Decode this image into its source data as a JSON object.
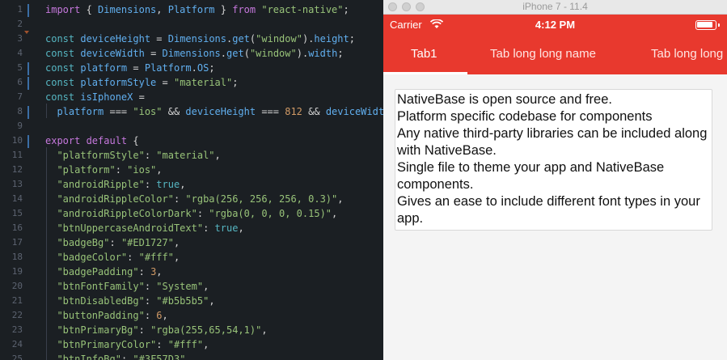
{
  "editor": {
    "lines": [
      {
        "n": "1",
        "tokens": [
          [
            "kw",
            "import "
          ],
          [
            "plain",
            "{ "
          ],
          [
            "id",
            "Dimensions"
          ],
          [
            "plain",
            ", "
          ],
          [
            "id",
            "Platform"
          ],
          [
            "plain",
            " } "
          ],
          [
            "kw",
            "from "
          ],
          [
            "str",
            "\"react-native\""
          ],
          [
            "plain",
            ";"
          ]
        ]
      },
      {
        "n": "2",
        "tokens": []
      },
      {
        "n": "3",
        "tokens": [
          [
            "kw2",
            "const "
          ],
          [
            "id",
            "deviceHeight"
          ],
          [
            "plain",
            " = "
          ],
          [
            "id",
            "Dimensions"
          ],
          [
            "plain",
            "."
          ],
          [
            "fn",
            "get"
          ],
          [
            "plain",
            "("
          ],
          [
            "str",
            "\"window\""
          ],
          [
            "plain",
            ")."
          ],
          [
            "id",
            "height"
          ],
          [
            "plain",
            ";"
          ]
        ]
      },
      {
        "n": "4",
        "tokens": [
          [
            "kw2",
            "const "
          ],
          [
            "id",
            "deviceWidth"
          ],
          [
            "plain",
            " = "
          ],
          [
            "id",
            "Dimensions"
          ],
          [
            "plain",
            "."
          ],
          [
            "fn",
            "get"
          ],
          [
            "plain",
            "("
          ],
          [
            "str",
            "\"window\""
          ],
          [
            "plain",
            ")."
          ],
          [
            "id",
            "width"
          ],
          [
            "plain",
            ";"
          ]
        ]
      },
      {
        "n": "5",
        "tokens": [
          [
            "kw2",
            "const "
          ],
          [
            "id",
            "platform"
          ],
          [
            "plain",
            " = "
          ],
          [
            "id",
            "Platform"
          ],
          [
            "plain",
            "."
          ],
          [
            "id",
            "OS"
          ],
          [
            "plain",
            ";"
          ]
        ]
      },
      {
        "n": "6",
        "tokens": [
          [
            "kw2",
            "const "
          ],
          [
            "id",
            "platformStyle"
          ],
          [
            "plain",
            " = "
          ],
          [
            "str",
            "\"material\""
          ],
          [
            "plain",
            ";"
          ]
        ]
      },
      {
        "n": "7",
        "tokens": [
          [
            "kw2",
            "const "
          ],
          [
            "id",
            "isIphoneX"
          ],
          [
            "plain",
            " ="
          ]
        ]
      },
      {
        "n": "8",
        "tokens": [
          [
            "plain",
            "  "
          ],
          [
            "id",
            "platform"
          ],
          [
            "plain",
            " === "
          ],
          [
            "str",
            "\"ios\""
          ],
          [
            "plain",
            " && "
          ],
          [
            "id",
            "deviceHeight"
          ],
          [
            "plain",
            " === "
          ],
          [
            "num",
            "812"
          ],
          [
            "plain",
            " && "
          ],
          [
            "id",
            "deviceWidt"
          ]
        ]
      },
      {
        "n": "9",
        "tokens": []
      },
      {
        "n": "10",
        "tokens": [
          [
            "kw",
            "export "
          ],
          [
            "kw",
            "default "
          ],
          [
            "plain",
            "{"
          ]
        ]
      },
      {
        "n": "11",
        "tokens": [
          [
            "plain",
            "  "
          ],
          [
            "str",
            "\"platformStyle\""
          ],
          [
            "plain",
            ": "
          ],
          [
            "str",
            "\"material\""
          ],
          [
            "plain",
            ","
          ]
        ]
      },
      {
        "n": "12",
        "tokens": [
          [
            "plain",
            "  "
          ],
          [
            "str",
            "\"platform\""
          ],
          [
            "plain",
            ": "
          ],
          [
            "str",
            "\"ios\""
          ],
          [
            "plain",
            ","
          ]
        ]
      },
      {
        "n": "13",
        "tokens": [
          [
            "plain",
            "  "
          ],
          [
            "str",
            "\"androidRipple\""
          ],
          [
            "plain",
            ": "
          ],
          [
            "bool",
            "true"
          ],
          [
            "plain",
            ","
          ]
        ]
      },
      {
        "n": "14",
        "tokens": [
          [
            "plain",
            "  "
          ],
          [
            "str",
            "\"androidRippleColor\""
          ],
          [
            "plain",
            ": "
          ],
          [
            "str",
            "\"rgba(256, 256, 256, 0.3)\""
          ],
          [
            "plain",
            ","
          ]
        ]
      },
      {
        "n": "15",
        "tokens": [
          [
            "plain",
            "  "
          ],
          [
            "str",
            "\"androidRippleColorDark\""
          ],
          [
            "plain",
            ": "
          ],
          [
            "str",
            "\"rgba(0, 0, 0, 0.15)\""
          ],
          [
            "plain",
            ","
          ]
        ]
      },
      {
        "n": "16",
        "tokens": [
          [
            "plain",
            "  "
          ],
          [
            "str",
            "\"btnUppercaseAndroidText\""
          ],
          [
            "plain",
            ": "
          ],
          [
            "bool",
            "true"
          ],
          [
            "plain",
            ","
          ]
        ]
      },
      {
        "n": "17",
        "tokens": [
          [
            "plain",
            "  "
          ],
          [
            "str",
            "\"badgeBg\""
          ],
          [
            "plain",
            ": "
          ],
          [
            "str",
            "\"#ED1727\""
          ],
          [
            "plain",
            ","
          ]
        ]
      },
      {
        "n": "18",
        "tokens": [
          [
            "plain",
            "  "
          ],
          [
            "str",
            "\"badgeColor\""
          ],
          [
            "plain",
            ": "
          ],
          [
            "str",
            "\"#fff\""
          ],
          [
            "plain",
            ","
          ]
        ]
      },
      {
        "n": "19",
        "tokens": [
          [
            "plain",
            "  "
          ],
          [
            "str",
            "\"badgePadding\""
          ],
          [
            "plain",
            ": "
          ],
          [
            "num",
            "3"
          ],
          [
            "plain",
            ","
          ]
        ]
      },
      {
        "n": "20",
        "tokens": [
          [
            "plain",
            "  "
          ],
          [
            "str",
            "\"btnFontFamily\""
          ],
          [
            "plain",
            ": "
          ],
          [
            "str",
            "\"System\""
          ],
          [
            "plain",
            ","
          ]
        ]
      },
      {
        "n": "21",
        "tokens": [
          [
            "plain",
            "  "
          ],
          [
            "str",
            "\"btnDisabledBg\""
          ],
          [
            "plain",
            ": "
          ],
          [
            "str",
            "\"#b5b5b5\""
          ],
          [
            "plain",
            ","
          ]
        ]
      },
      {
        "n": "22",
        "tokens": [
          [
            "plain",
            "  "
          ],
          [
            "str",
            "\"buttonPadding\""
          ],
          [
            "plain",
            ": "
          ],
          [
            "num",
            "6"
          ],
          [
            "plain",
            ","
          ]
        ]
      },
      {
        "n": "23",
        "tokens": [
          [
            "plain",
            "  "
          ],
          [
            "str",
            "\"btnPrimaryBg\""
          ],
          [
            "plain",
            ": "
          ],
          [
            "str",
            "\"rgba(255,65,54,1)\""
          ],
          [
            "plain",
            ","
          ]
        ]
      },
      {
        "n": "24",
        "tokens": [
          [
            "plain",
            "  "
          ],
          [
            "str",
            "\"btnPrimaryColor\""
          ],
          [
            "plain",
            ": "
          ],
          [
            "str",
            "\"#fff\""
          ],
          [
            "plain",
            ","
          ]
        ]
      },
      {
        "n": "25",
        "tokens": [
          [
            "plain",
            "  "
          ],
          [
            "str",
            "\"btnInfoBg\""
          ],
          [
            "plain",
            ": "
          ],
          [
            "str",
            "\"#3F57D3\""
          ],
          [
            "plain",
            ","
          ]
        ]
      }
    ]
  },
  "simulator": {
    "title": "iPhone 7 - 11.4",
    "status": {
      "carrier": "Carrier",
      "time": "4:12 PM"
    },
    "tabs": [
      {
        "label": "Tab1",
        "active": true
      },
      {
        "label": "Tab long long name",
        "active": false
      },
      {
        "label": "Tab long long name",
        "active": false
      }
    ],
    "paragraphs": [
      "NativeBase is open source and free.",
      "Platform specific codebase for components",
      "Any native third-party libraries can be included along with NativeBase.",
      "Single file to theme your app and NativeBase components.",
      "Gives an ease to include different font types in your app."
    ],
    "accent_color": "#e8392e"
  }
}
